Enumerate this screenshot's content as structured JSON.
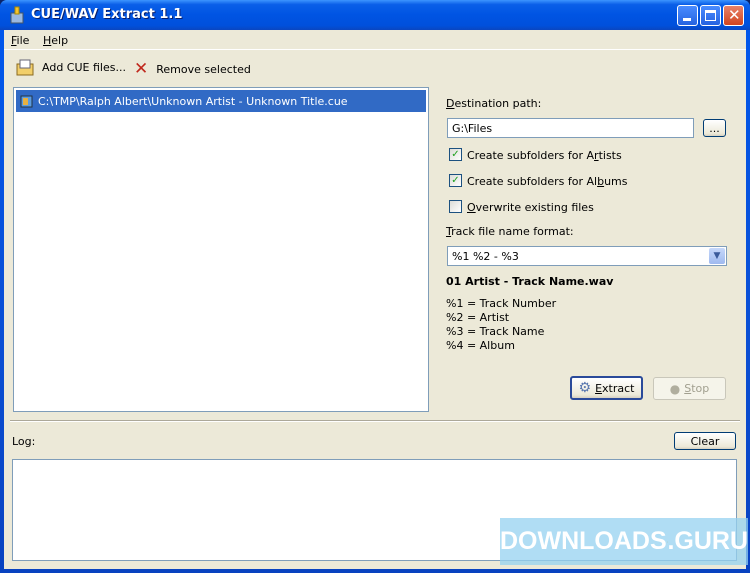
{
  "window": {
    "title": "CUE/WAV Extract 1.1"
  },
  "menu": [
    {
      "key": "F",
      "rest": "ile"
    },
    {
      "key": "H",
      "rest": "elp"
    }
  ],
  "toolbar": {
    "add_label": "Add CUE files...",
    "remove_label": "Remove selected"
  },
  "files": [
    {
      "path": "C:\\TMP\\Ralph Albert\\Unknown Artist - Unknown Title.cue",
      "selected": true
    }
  ],
  "options": {
    "dest_label": {
      "pre": "",
      "key": "D",
      "post": "estination path:"
    },
    "dest_value": "G:\\Files",
    "browse_label": "...",
    "artists": {
      "pre": "Create subfolders for A",
      "key": "r",
      "post": "tists",
      "checked": true
    },
    "albums": {
      "pre": "Create subfolders for Al",
      "key": "b",
      "post": "ums",
      "checked": true
    },
    "overwrite": {
      "pre": "",
      "key": "O",
      "post": "verwrite existing files",
      "checked": false
    },
    "format_label": {
      "pre": "",
      "key": "T",
      "post": "rack file name format:"
    },
    "format_value": "%1 %2 - %3",
    "preview": "01 Artist - Track Name.wav",
    "legend": [
      "%1 = Track Number",
      "%2 = Artist",
      "%3 = Track Name",
      "%4 = Album"
    ],
    "extract": {
      "key": "E",
      "post": "xtract"
    },
    "stop": {
      "key": "S",
      "post": "top",
      "disabled": true
    }
  },
  "log": {
    "label": "Log:",
    "clear_label": "Clear"
  },
  "watermark": {
    "left": "DOWNLOADS",
    "right": ".GURU"
  },
  "colors": {
    "selection": "#316ac5",
    "titlebar": "#0054e3",
    "face": "#ece9d8"
  }
}
